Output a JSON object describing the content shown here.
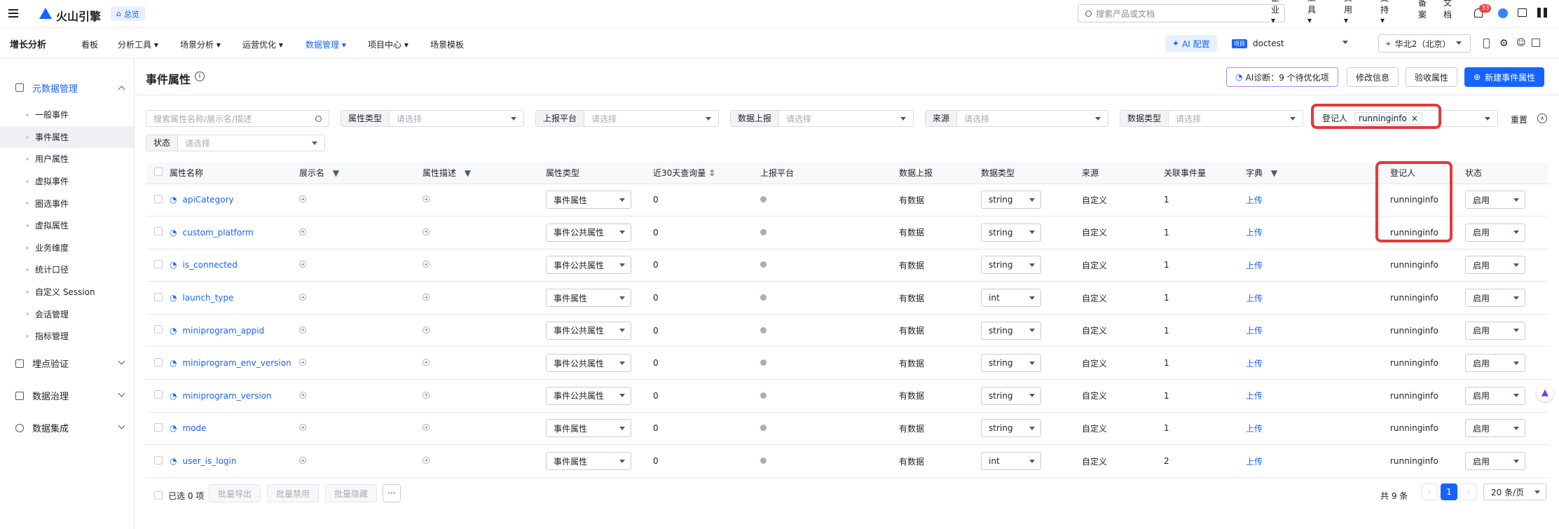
{
  "topbar": {
    "brand": "火山引擎",
    "overview": "总览",
    "search_placeholder": "搜索产品或文档",
    "links": [
      "企业",
      "工具",
      "费用",
      "支持",
      "备案",
      "文档"
    ],
    "badge": "33"
  },
  "nav": {
    "app": "增长分析",
    "items": [
      "看板",
      "分析工具",
      "场景分析",
      "运营优化",
      "数据管理",
      "项目中心",
      "场景模板"
    ],
    "ai": "AI 配置",
    "project_tag": "项目",
    "project": "doctest",
    "region": "华北2（北京）"
  },
  "sidebar": {
    "group1": "元数据管理",
    "items": [
      "一般事件",
      "事件属性",
      "用户属性",
      "虚拟事件",
      "圈选事件",
      "虚拟属性",
      "业务维度",
      "统计口径",
      "自定义 Session",
      "会话管理",
      "指标管理"
    ],
    "groups": [
      "埋点验证",
      "数据治理",
      "数据集成"
    ]
  },
  "page": {
    "title": "事件属性",
    "ai_diag": "AI诊断：9 个待优化项",
    "edit": "修改信息",
    "verify": "验收属性",
    "create": "新建事件属性"
  },
  "filters": {
    "search_placeholder": "搜索属性名称/展示名/描述",
    "labels": [
      "属性类型",
      "上报平台",
      "数据上报",
      "来源",
      "数据类型"
    ],
    "placeholder": "请选择",
    "registrant_label": "登记人",
    "registrant_tag": "runninginfo",
    "reset": "重置",
    "status_label": "状态"
  },
  "table": {
    "headers": [
      "属性名称",
      "展示名",
      "属性描述",
      "属性类型",
      "近30天查询量",
      "上报平台",
      "数据上报",
      "数据类型",
      "来源",
      "关联事件量",
      "字典",
      "登记人",
      "状态"
    ],
    "rows": [
      {
        "name": "apiCategory",
        "type": "事件属性",
        "queries": "0",
        "report": "有数据",
        "dtype": "string",
        "source": "自定义",
        "events": "1",
        "dict": "上传",
        "registrant": "runninginfo",
        "status": "启用"
      },
      {
        "name": "custom_platform",
        "type": "事件公共属性",
        "queries": "0",
        "report": "有数据",
        "dtype": "string",
        "source": "自定义",
        "events": "1",
        "dict": "上传",
        "registrant": "runninginfo",
        "status": "启用"
      },
      {
        "name": "is_connected",
        "type": "事件公共属性",
        "queries": "0",
        "report": "有数据",
        "dtype": "string",
        "source": "自定义",
        "events": "1",
        "dict": "上传",
        "registrant": "runninginfo",
        "status": "启用"
      },
      {
        "name": "launch_type",
        "type": "事件属性",
        "queries": "0",
        "report": "有数据",
        "dtype": "int",
        "source": "自定义",
        "events": "1",
        "dict": "上传",
        "registrant": "runninginfo",
        "status": "启用"
      },
      {
        "name": "miniprogram_appid",
        "type": "事件公共属性",
        "queries": "0",
        "report": "有数据",
        "dtype": "string",
        "source": "自定义",
        "events": "1",
        "dict": "上传",
        "registrant": "runninginfo",
        "status": "启用"
      },
      {
        "name": "miniprogram_env_version",
        "type": "事件公共属性",
        "queries": "0",
        "report": "有数据",
        "dtype": "string",
        "source": "自定义",
        "events": "1",
        "dict": "上传",
        "registrant": "runninginfo",
        "status": "启用"
      },
      {
        "name": "miniprogram_version",
        "type": "事件公共属性",
        "queries": "0",
        "report": "有数据",
        "dtype": "string",
        "source": "自定义",
        "events": "1",
        "dict": "上传",
        "registrant": "runninginfo",
        "status": "启用"
      },
      {
        "name": "mode",
        "type": "事件属性",
        "queries": "0",
        "report": "有数据",
        "dtype": "string",
        "source": "自定义",
        "events": "1",
        "dict": "上传",
        "registrant": "runninginfo",
        "status": "启用"
      },
      {
        "name": "user_is_login",
        "type": "事件属性",
        "queries": "0",
        "report": "有数据",
        "dtype": "int",
        "source": "自定义",
        "events": "2",
        "dict": "上传",
        "registrant": "runninginfo",
        "status": "启用"
      }
    ]
  },
  "footer": {
    "selected": "已选 0 项",
    "actions": [
      "批量导出",
      "批量禁用",
      "批量隐藏"
    ],
    "more": "···",
    "total": "共 9 条",
    "page": "1",
    "page_size": "20 条/页"
  },
  "colors": {
    "primary": "#1664ff",
    "highlight": "#e53935"
  }
}
